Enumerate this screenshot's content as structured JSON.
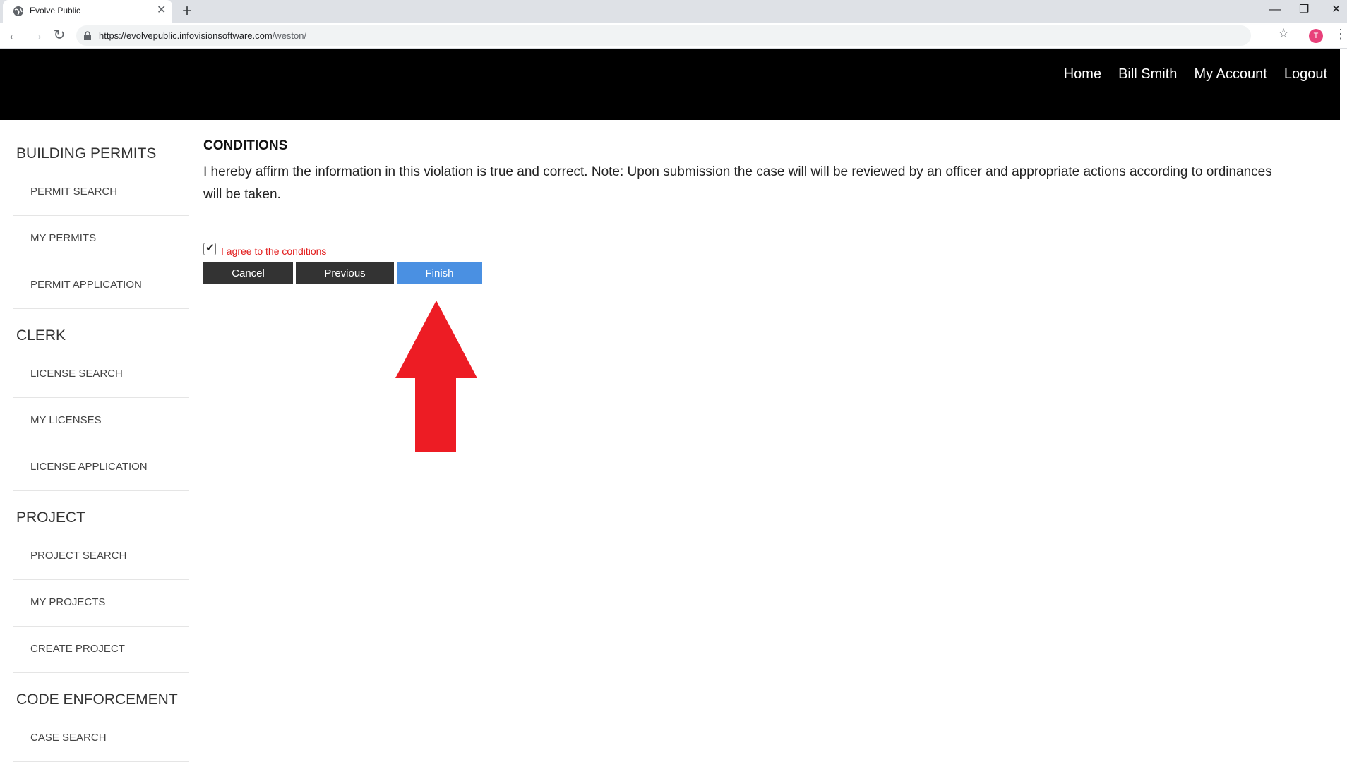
{
  "browser": {
    "tab_title": "Evolve Public",
    "url_host": "https://evolvepublic.infovisionsoftware.com",
    "url_path": "/weston/",
    "profile_initial": "T"
  },
  "header": {
    "nav": [
      "Home",
      "Bill Smith",
      "My Account",
      "Logout"
    ]
  },
  "sidebar": {
    "sections": [
      {
        "title": "BUILDING PERMITS",
        "items": [
          "PERMIT SEARCH",
          "MY PERMITS",
          "PERMIT APPLICATION"
        ]
      },
      {
        "title": "CLERK",
        "items": [
          "LICENSE SEARCH",
          "MY LICENSES",
          "LICENSE APPLICATION"
        ]
      },
      {
        "title": "PROJECT",
        "items": [
          "PROJECT SEARCH",
          "MY PROJECTS",
          "CREATE PROJECT"
        ]
      },
      {
        "title": "CODE ENFORCEMENT",
        "items": [
          "CASE SEARCH"
        ]
      }
    ]
  },
  "main": {
    "title": "CONDITIONS",
    "text": "I hereby affirm the information in this violation is true and correct. Note: Upon submission the case will will be reviewed by an officer and appropriate actions according to ordinances will be taken.",
    "agree_label": "I agree to the conditions",
    "agree_checked": true,
    "buttons": {
      "cancel": "Cancel",
      "previous": "Previous",
      "finish": "Finish"
    }
  },
  "colors": {
    "header_bg": "#000000",
    "finish_button": "#4a90e2",
    "dark_button": "#333333",
    "agree_label": "#e21b1b",
    "arrow": "#ed1c24"
  }
}
